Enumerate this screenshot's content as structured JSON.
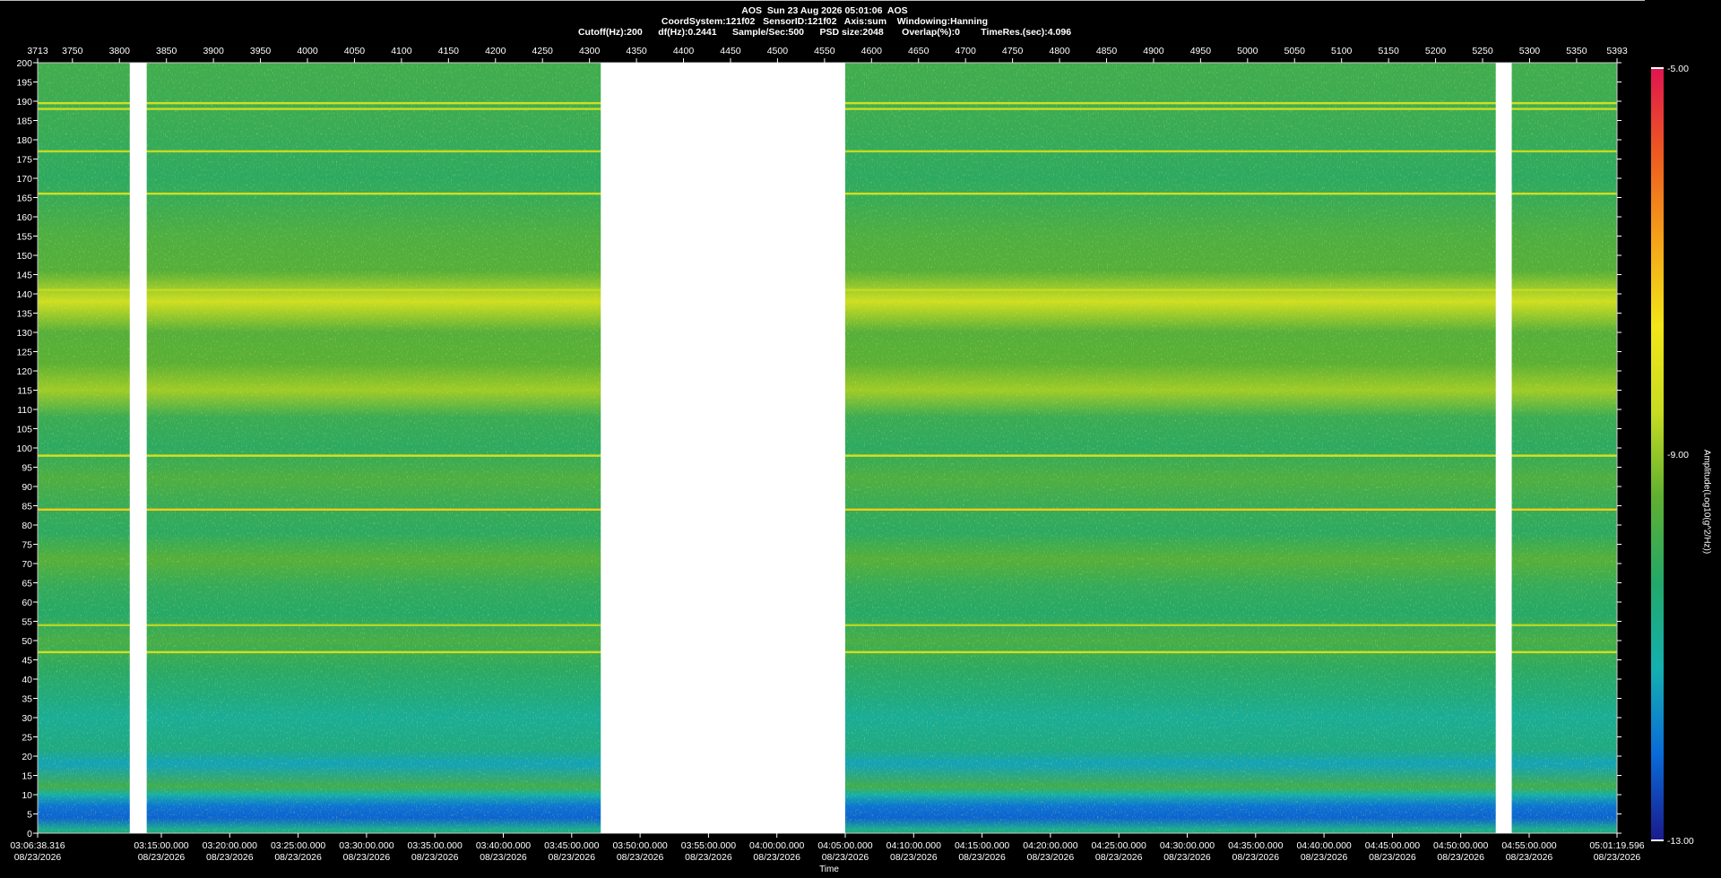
{
  "header": {
    "line1": "AOS  Sun 23 Aug 2026 05:01:06  AOS",
    "line2": "CoordSystem:121f02   SensorID:121f02   Axis:sum    Windowing:Hanning",
    "line3": "Cutoff(Hz):200      df(Hz):0.2441      Sample/Sec:500      PSD size:2048       Overlap(%):0        TimeRes.(sec):4.096"
  },
  "chart_data": {
    "type": "heatmap",
    "ylabel": "",
    "xlabel": "Time",
    "ylim": [
      0,
      200
    ],
    "y_ticks": [
      200,
      195,
      190,
      185,
      180,
      175,
      170,
      165,
      160,
      155,
      150,
      145,
      140,
      135,
      130,
      125,
      120,
      115,
      110,
      105,
      100,
      95,
      90,
      85,
      80,
      75,
      70,
      65,
      60,
      55,
      50,
      45,
      40,
      35,
      30,
      25,
      20,
      15,
      10,
      5,
      0
    ],
    "top_axis_ticks": [
      "3713",
      "3750",
      "3800",
      "3850",
      "3900",
      "3950",
      "4000",
      "4050",
      "4100",
      "4150",
      "4200",
      "4250",
      "4300",
      "4350",
      "4400",
      "4450",
      "4500",
      "4550",
      "4600",
      "4650",
      "4700",
      "4750",
      "4800",
      "4850",
      "4900",
      "4950",
      "5000",
      "5050",
      "5100",
      "5150",
      "5200",
      "5250",
      "5300",
      "5350",
      "5393"
    ],
    "top_axis_range": [
      3713,
      5393
    ],
    "time_ticks": [
      {
        "time": "03:06:38.316",
        "date": "08/23/2026"
      },
      {
        "time": "03:15:00.000",
        "date": "08/23/2026"
      },
      {
        "time": "03:20:00.000",
        "date": "08/23/2026"
      },
      {
        "time": "03:25:00.000",
        "date": "08/23/2026"
      },
      {
        "time": "03:30:00.000",
        "date": "08/23/2026"
      },
      {
        "time": "03:35:00.000",
        "date": "08/23/2026"
      },
      {
        "time": "03:40:00.000",
        "date": "08/23/2026"
      },
      {
        "time": "03:45:00.000",
        "date": "08/23/2026"
      },
      {
        "time": "03:50:00.000",
        "date": "08/23/2026"
      },
      {
        "time": "03:55:00.000",
        "date": "08/23/2026"
      },
      {
        "time": "04:00:00.000",
        "date": "08/23/2026"
      },
      {
        "time": "04:05:00.000",
        "date": "08/23/2026"
      },
      {
        "time": "04:10:00.000",
        "date": "08/23/2026"
      },
      {
        "time": "04:15:00.000",
        "date": "08/23/2026"
      },
      {
        "time": "04:20:00.000",
        "date": "08/23/2026"
      },
      {
        "time": "04:25:00.000",
        "date": "08/23/2026"
      },
      {
        "time": "04:30:00.000",
        "date": "08/23/2026"
      },
      {
        "time": "04:35:00.000",
        "date": "08/23/2026"
      },
      {
        "time": "04:40:00.000",
        "date": "08/23/2026"
      },
      {
        "time": "04:45:00.000",
        "date": "08/23/2026"
      },
      {
        "time": "04:50:00.000",
        "date": "08/23/2026"
      },
      {
        "time": "04:55:00.000",
        "date": "08/23/2026"
      },
      {
        "time": "05:01:19.596",
        "date": "08/23/2026"
      }
    ],
    "gaps_top_axis": [
      [
        3811,
        3829
      ],
      [
        4312,
        4572
      ],
      [
        5264,
        5281
      ]
    ],
    "spectral_lines_hz": [
      {
        "hz": 189.5,
        "level": -8.3
      },
      {
        "hz": 188,
        "level": -8.5
      },
      {
        "hz": 177,
        "level": -8.6
      },
      {
        "hz": 166,
        "level": -8.4
      },
      {
        "hz": 141,
        "level": -8.6
      },
      {
        "hz": 98,
        "level": -8.2
      },
      {
        "hz": 84,
        "level": -7.3
      },
      {
        "hz": 54,
        "level": -8.7
      },
      {
        "hz": 47,
        "level": -8.4
      }
    ],
    "background_profile": [
      {
        "hz": 200,
        "level": -9.9
      },
      {
        "hz": 185,
        "level": -10.0
      },
      {
        "hz": 170,
        "level": -10.2
      },
      {
        "hz": 155,
        "level": -9.7
      },
      {
        "hz": 146,
        "level": -9.6
      },
      {
        "hz": 138,
        "level": -8.4
      },
      {
        "hz": 130,
        "level": -9.6
      },
      {
        "hz": 122,
        "level": -9.5
      },
      {
        "hz": 115,
        "level": -8.9
      },
      {
        "hz": 108,
        "level": -10.0
      },
      {
        "hz": 100,
        "level": -10.2
      },
      {
        "hz": 92,
        "level": -9.7
      },
      {
        "hz": 86,
        "level": -10.0
      },
      {
        "hz": 78,
        "level": -10.2
      },
      {
        "hz": 71,
        "level": -9.6
      },
      {
        "hz": 64,
        "level": -10.1
      },
      {
        "hz": 57,
        "level": -10.3
      },
      {
        "hz": 50,
        "level": -9.8
      },
      {
        "hz": 43,
        "level": -10.2
      },
      {
        "hz": 35,
        "level": -10.6
      },
      {
        "hz": 30,
        "level": -10.9
      },
      {
        "hz": 22,
        "level": -10.6
      },
      {
        "hz": 18,
        "level": -11.4
      },
      {
        "hz": 12,
        "level": -9.9
      },
      {
        "hz": 10,
        "level": -11.1
      },
      {
        "hz": 7,
        "level": -12.0
      },
      {
        "hz": 4,
        "level": -12.2
      },
      {
        "hz": 1,
        "level": -10.8
      },
      {
        "hz": 0,
        "level": -10.5
      }
    ],
    "colorbar": {
      "label": "Amplitude(Log10(g^2/Hz))",
      "max_label": "-5.00",
      "mid_label": "-9.00",
      "min_label": "-13.00",
      "range": [
        -13,
        -5
      ],
      "colors": [
        "#1a1a8c",
        "#0a6ad8",
        "#14b0b0",
        "#23a86a",
        "#5fb030",
        "#c8dc22",
        "#f2e618",
        "#f4a21a",
        "#ee5a20",
        "#e01450"
      ]
    }
  }
}
